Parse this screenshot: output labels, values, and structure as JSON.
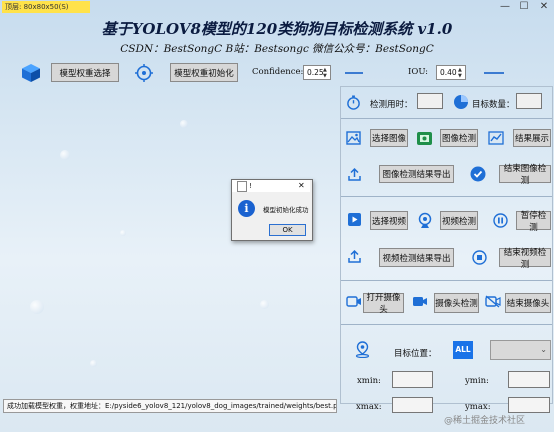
{
  "window": {
    "title_tag": "顶层: 80x80x50(S)",
    "minimize": "—",
    "maximize": "☐",
    "close": "✕"
  },
  "header": {
    "title": "基于YOLOV8模型的120类狗狗目标检测系统 v1.0",
    "subtitle": "CSDN：BestSongC   B站：Bestsongc   微信公众号：BestSongC"
  },
  "toolbar": {
    "select_weights": "模型权重选择",
    "init_weights": "模型权重初始化",
    "confidence_label": "Confidence:",
    "confidence_value": "0.25",
    "confidence_fraction": 0.25,
    "iou_label": "IOU:",
    "iou_value": "0.40",
    "iou_fraction": 0.4
  },
  "stats": {
    "time_label": "检测用时：",
    "count_label": "目标数量："
  },
  "image_section": {
    "select_image": "选择图像",
    "detect_image": "图像检测",
    "show_result": "结果展示",
    "export_image": "图像检测结果导出",
    "end_image": "结束图像检测"
  },
  "video_section": {
    "select_video": "选择视频",
    "detect_video": "视频检测",
    "pause_detect": "暂停检测",
    "export_video": "视频检测结果导出",
    "end_video": "结束视频检测"
  },
  "camera_section": {
    "open_camera": "打开摄像头",
    "detect_camera": "摄像头检测",
    "close_camera": "结束摄像头"
  },
  "position": {
    "target_label": "目标位置：",
    "all_badge": "ALL",
    "xmin": "xmin:",
    "ymin": "ymin:",
    "xmax": "xmax:",
    "ymax": "ymax:"
  },
  "dialog": {
    "title": "!",
    "message": "模型初始化成功",
    "ok": "OK",
    "close": "✕"
  },
  "status_bar": {
    "text": "成功加载模型权重，权重地址：E:/pyside6_yolov8_121/yolov8_dog_images/trained/weights/best.pt"
  },
  "watermark": "@稀土掘金技术社区",
  "colors": {
    "accent": "#1f6fd6",
    "badge": "#1a73e8"
  }
}
